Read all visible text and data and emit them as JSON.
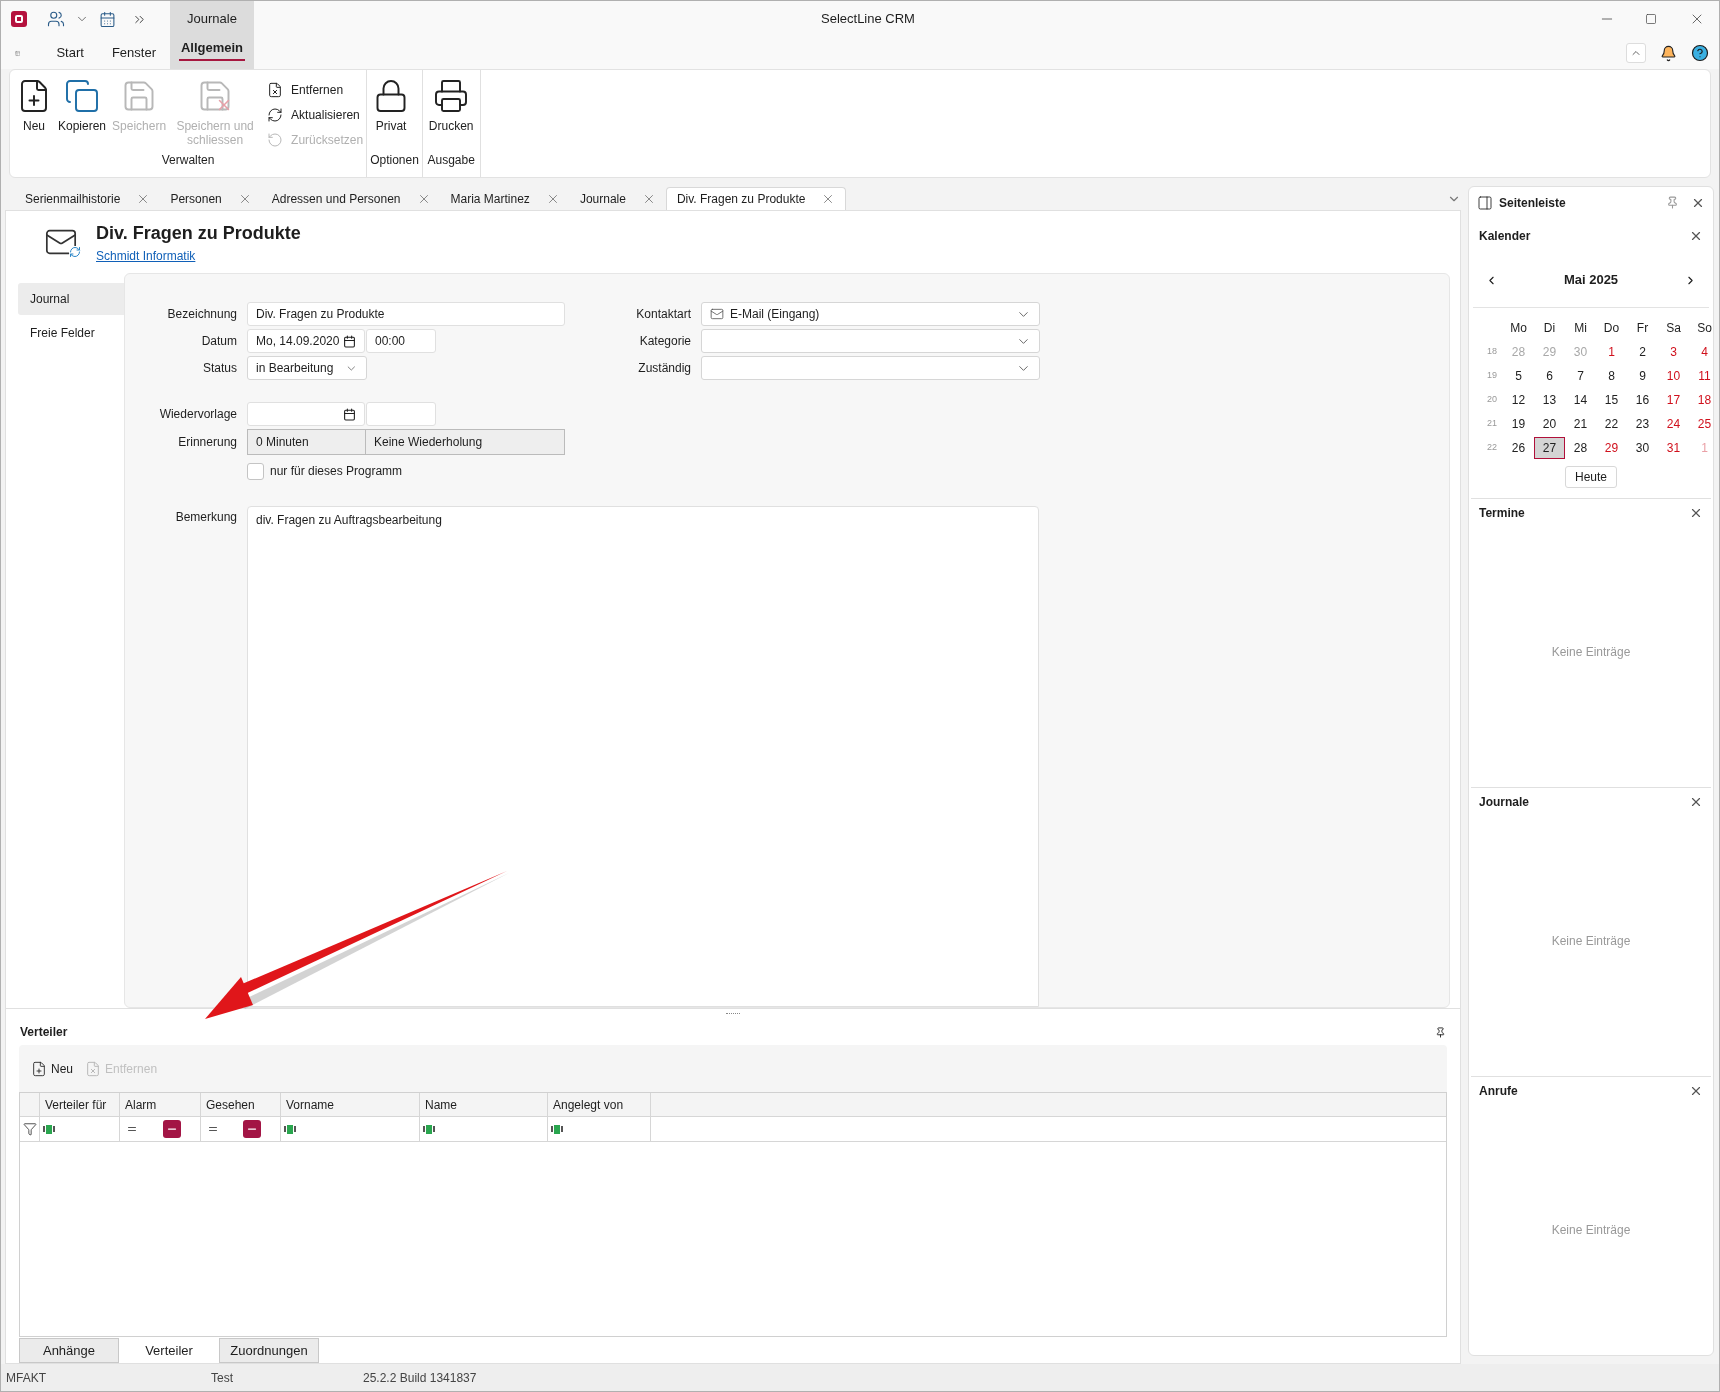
{
  "window": {
    "title": "SelectLine CRM"
  },
  "context_tab": {
    "label": "Journale"
  },
  "menu_tabs": [
    {
      "label": "Start",
      "selected": false
    },
    {
      "label": "Fenster",
      "selected": false
    },
    {
      "label": "Allgemein",
      "selected": true
    }
  ],
  "ribbon_groups": [
    {
      "label": "Verwalten",
      "large": [
        {
          "label": "Neu",
          "kind": "new",
          "disabled": false
        },
        {
          "label": "Kopieren",
          "kind": "copy",
          "disabled": false
        },
        {
          "label": "Speichern",
          "kind": "save",
          "disabled": true
        },
        {
          "label": "Speichern und schliessen",
          "kind": "save_close",
          "disabled": true
        }
      ],
      "small": [
        {
          "label": "Entfernen",
          "kind": "remove",
          "disabled": false
        },
        {
          "label": "Aktualisieren",
          "kind": "refresh",
          "disabled": false
        },
        {
          "label": "Zurücksetzen",
          "kind": "reset",
          "disabled": true
        }
      ]
    },
    {
      "label": "Optionen",
      "large": [
        {
          "label": "Privat",
          "kind": "lock",
          "disabled": false
        }
      ]
    },
    {
      "label": "Ausgabe",
      "large": [
        {
          "label": "Drucken",
          "kind": "print",
          "disabled": false
        }
      ]
    }
  ],
  "doc_tabs": [
    {
      "label": "Serienmailhistorie",
      "selected": false
    },
    {
      "label": "Personen",
      "selected": false
    },
    {
      "label": "Adressen und Personen",
      "selected": false
    },
    {
      "label": "Maria Martinez",
      "selected": false
    },
    {
      "label": "Journale",
      "selected": false
    },
    {
      "label": "Div. Fragen zu Produkte",
      "selected": true
    }
  ],
  "record": {
    "title": "Div. Fragen zu Produkte",
    "link": "Schmidt Informatik"
  },
  "nav": [
    {
      "label": "Journal",
      "selected": true
    },
    {
      "label": "Freie Felder",
      "selected": false
    }
  ],
  "form": {
    "designation": {
      "label": "Bezeichnung",
      "value": "Div. Fragen zu Produkte"
    },
    "date": {
      "label": "Datum",
      "value": "Mo, 14.09.2020",
      "time": "00:00"
    },
    "status": {
      "label": "Status",
      "value": "in Bearbeitung"
    },
    "follow_up": {
      "label": "Wiedervorlage"
    },
    "reminder": {
      "label": "Erinnerung",
      "value": "0 Minuten",
      "repeat": "Keine Wiederholung"
    },
    "program_only": {
      "label": "nur für dieses Programm",
      "checked": false
    },
    "contact_type": {
      "label": "Kontaktart",
      "value": "E-Mail (Eingang)"
    },
    "category": {
      "label": "Kategorie"
    },
    "responsible": {
      "label": "Zuständig"
    },
    "remark": {
      "label": "Bemerkung",
      "value": "div. Fragen zu Auftragsbearbeitung"
    }
  },
  "distribution": {
    "title": "Verteiler",
    "toolbar": [
      {
        "label": "Neu",
        "kind": "new",
        "disabled": false
      },
      {
        "label": "Entfernen",
        "kind": "remove",
        "disabled": true
      }
    ],
    "columns": [
      {
        "label": "Verteiler für",
        "kind": "text"
      },
      {
        "label": "Alarm",
        "kind": "bool"
      },
      {
        "label": "Gesehen",
        "kind": "bool"
      },
      {
        "label": "Vorname",
        "kind": "text"
      },
      {
        "label": "Name",
        "kind": "text"
      },
      {
        "label": "Angelegt von",
        "kind": "text"
      }
    ]
  },
  "bottom_tabs": [
    {
      "label": "Anhänge",
      "selected": false
    },
    {
      "label": "Verteiler",
      "selected": true
    },
    {
      "label": "Zuordnungen",
      "selected": false
    }
  ],
  "status_bar": [
    "MFAKT",
    "Test",
    "25.2.2 Build 1341837"
  ],
  "sidebar": {
    "title": "Seitenleiste",
    "calendar": {
      "title": "Kalender",
      "month": "Mai 2025",
      "weekdays": [
        "Mo",
        "Di",
        "Mi",
        "Do",
        "Fr",
        "Sa",
        "So"
      ],
      "today_button": "Heute",
      "weeks": [
        {
          "number": "18",
          "days": [
            {
              "day": "28",
              "kind": "other",
              "selected": false
            },
            {
              "day": "29",
              "kind": "other",
              "selected": false
            },
            {
              "day": "30",
              "kind": "other",
              "selected": false
            },
            {
              "day": "1",
              "kind": "holiday",
              "selected": false
            },
            {
              "day": "2",
              "kind": "normal",
              "selected": false
            },
            {
              "day": "3",
              "kind": "holiday",
              "selected": false
            },
            {
              "day": "4",
              "kind": "holiday",
              "selected": false
            }
          ]
        },
        {
          "number": "19",
          "days": [
            {
              "day": "5",
              "kind": "normal",
              "selected": false
            },
            {
              "day": "6",
              "kind": "normal",
              "selected": false
            },
            {
              "day": "7",
              "kind": "normal",
              "selected": false
            },
            {
              "day": "8",
              "kind": "normal",
              "selected": false
            },
            {
              "day": "9",
              "kind": "normal",
              "selected": false
            },
            {
              "day": "10",
              "kind": "holiday",
              "selected": false
            },
            {
              "day": "11",
              "kind": "holiday",
              "selected": false
            }
          ]
        },
        {
          "number": "20",
          "days": [
            {
              "day": "12",
              "kind": "normal",
              "selected": false
            },
            {
              "day": "13",
              "kind": "normal",
              "selected": false
            },
            {
              "day": "14",
              "kind": "normal",
              "selected": false
            },
            {
              "day": "15",
              "kind": "normal",
              "selected": false
            },
            {
              "day": "16",
              "kind": "normal",
              "selected": false
            },
            {
              "day": "17",
              "kind": "holiday",
              "selected": false
            },
            {
              "day": "18",
              "kind": "holiday",
              "selected": false
            }
          ]
        },
        {
          "number": "21",
          "days": [
            {
              "day": "19",
              "kind": "normal",
              "selected": false
            },
            {
              "day": "20",
              "kind": "normal",
              "selected": false
            },
            {
              "day": "21",
              "kind": "normal",
              "selected": false
            },
            {
              "day": "22",
              "kind": "normal",
              "selected": false
            },
            {
              "day": "23",
              "kind": "normal",
              "selected": false
            },
            {
              "day": "24",
              "kind": "holiday",
              "selected": false
            },
            {
              "day": "25",
              "kind": "holiday",
              "selected": false
            }
          ]
        },
        {
          "number": "22",
          "days": [
            {
              "day": "26",
              "kind": "normal",
              "selected": false
            },
            {
              "day": "27",
              "kind": "normal",
              "selected": true
            },
            {
              "day": "28",
              "kind": "normal",
              "selected": false
            },
            {
              "day": "29",
              "kind": "holiday",
              "selected": false
            },
            {
              "day": "30",
              "kind": "normal",
              "selected": false
            },
            {
              "day": "31",
              "kind": "holiday",
              "selected": false
            },
            {
              "day": "1",
              "kind": "other_holiday",
              "selected": false
            }
          ]
        }
      ]
    },
    "panels": [
      {
        "title": "Termine",
        "empty": "Keine Einträge"
      },
      {
        "title": "Journale",
        "empty": "Keine Einträge"
      },
      {
        "title": "Anrufe",
        "empty": "Keine Einträge"
      }
    ]
  }
}
